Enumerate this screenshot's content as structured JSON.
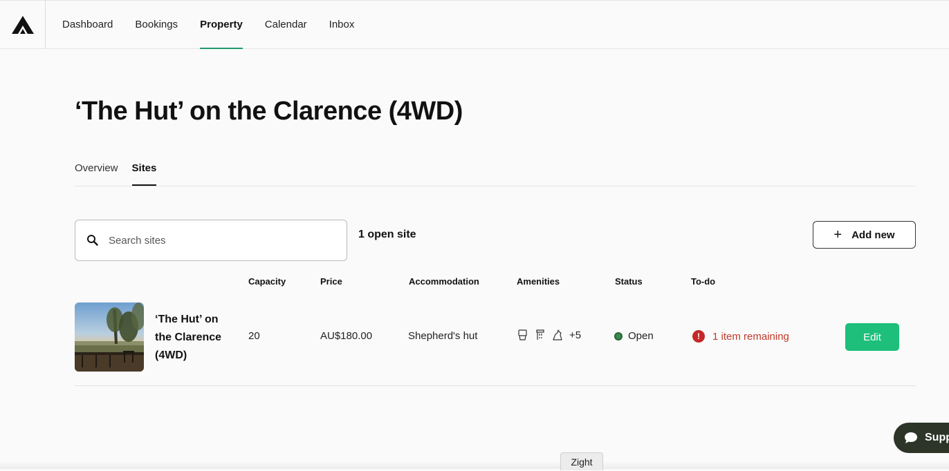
{
  "nav": {
    "items": [
      {
        "label": "Dashboard",
        "active": false
      },
      {
        "label": "Bookings",
        "active": false
      },
      {
        "label": "Property",
        "active": true
      },
      {
        "label": "Calendar",
        "active": false
      },
      {
        "label": "Inbox",
        "active": false
      }
    ]
  },
  "property": {
    "title": "‘The Hut’ on the Clarence (4WD)"
  },
  "tabs": [
    {
      "label": "Overview",
      "active": false
    },
    {
      "label": "Sites",
      "active": true
    }
  ],
  "toolbar": {
    "search_placeholder": "Search sites",
    "open_count": "1 open site",
    "add_label": "Add new"
  },
  "table": {
    "headers": {
      "capacity": "Capacity",
      "price": "Price",
      "accommodation": "Accommodation",
      "amenities": "Amenities",
      "status": "Status",
      "todo": "To-do"
    },
    "rows": [
      {
        "name": "‘The Hut’ on the Clarence (4WD)",
        "capacity": "20",
        "price": "AU$180.00",
        "accommodation": "Shepherd's hut",
        "amenities_icons": [
          "toilet-icon",
          "shower-icon",
          "pets-icon"
        ],
        "amenities_more": "+5",
        "status": "Open",
        "todo": "1 item remaining",
        "edit_label": "Edit"
      }
    ]
  },
  "support": {
    "label": "Supp"
  },
  "zight": {
    "label": "Zight"
  },
  "colors": {
    "accent_green": "#1dbf7a",
    "nav_underline": "#1f9a6a",
    "status_open": "#2d6a3e",
    "todo_red": "#c62828",
    "support_bg": "#2c3527"
  }
}
